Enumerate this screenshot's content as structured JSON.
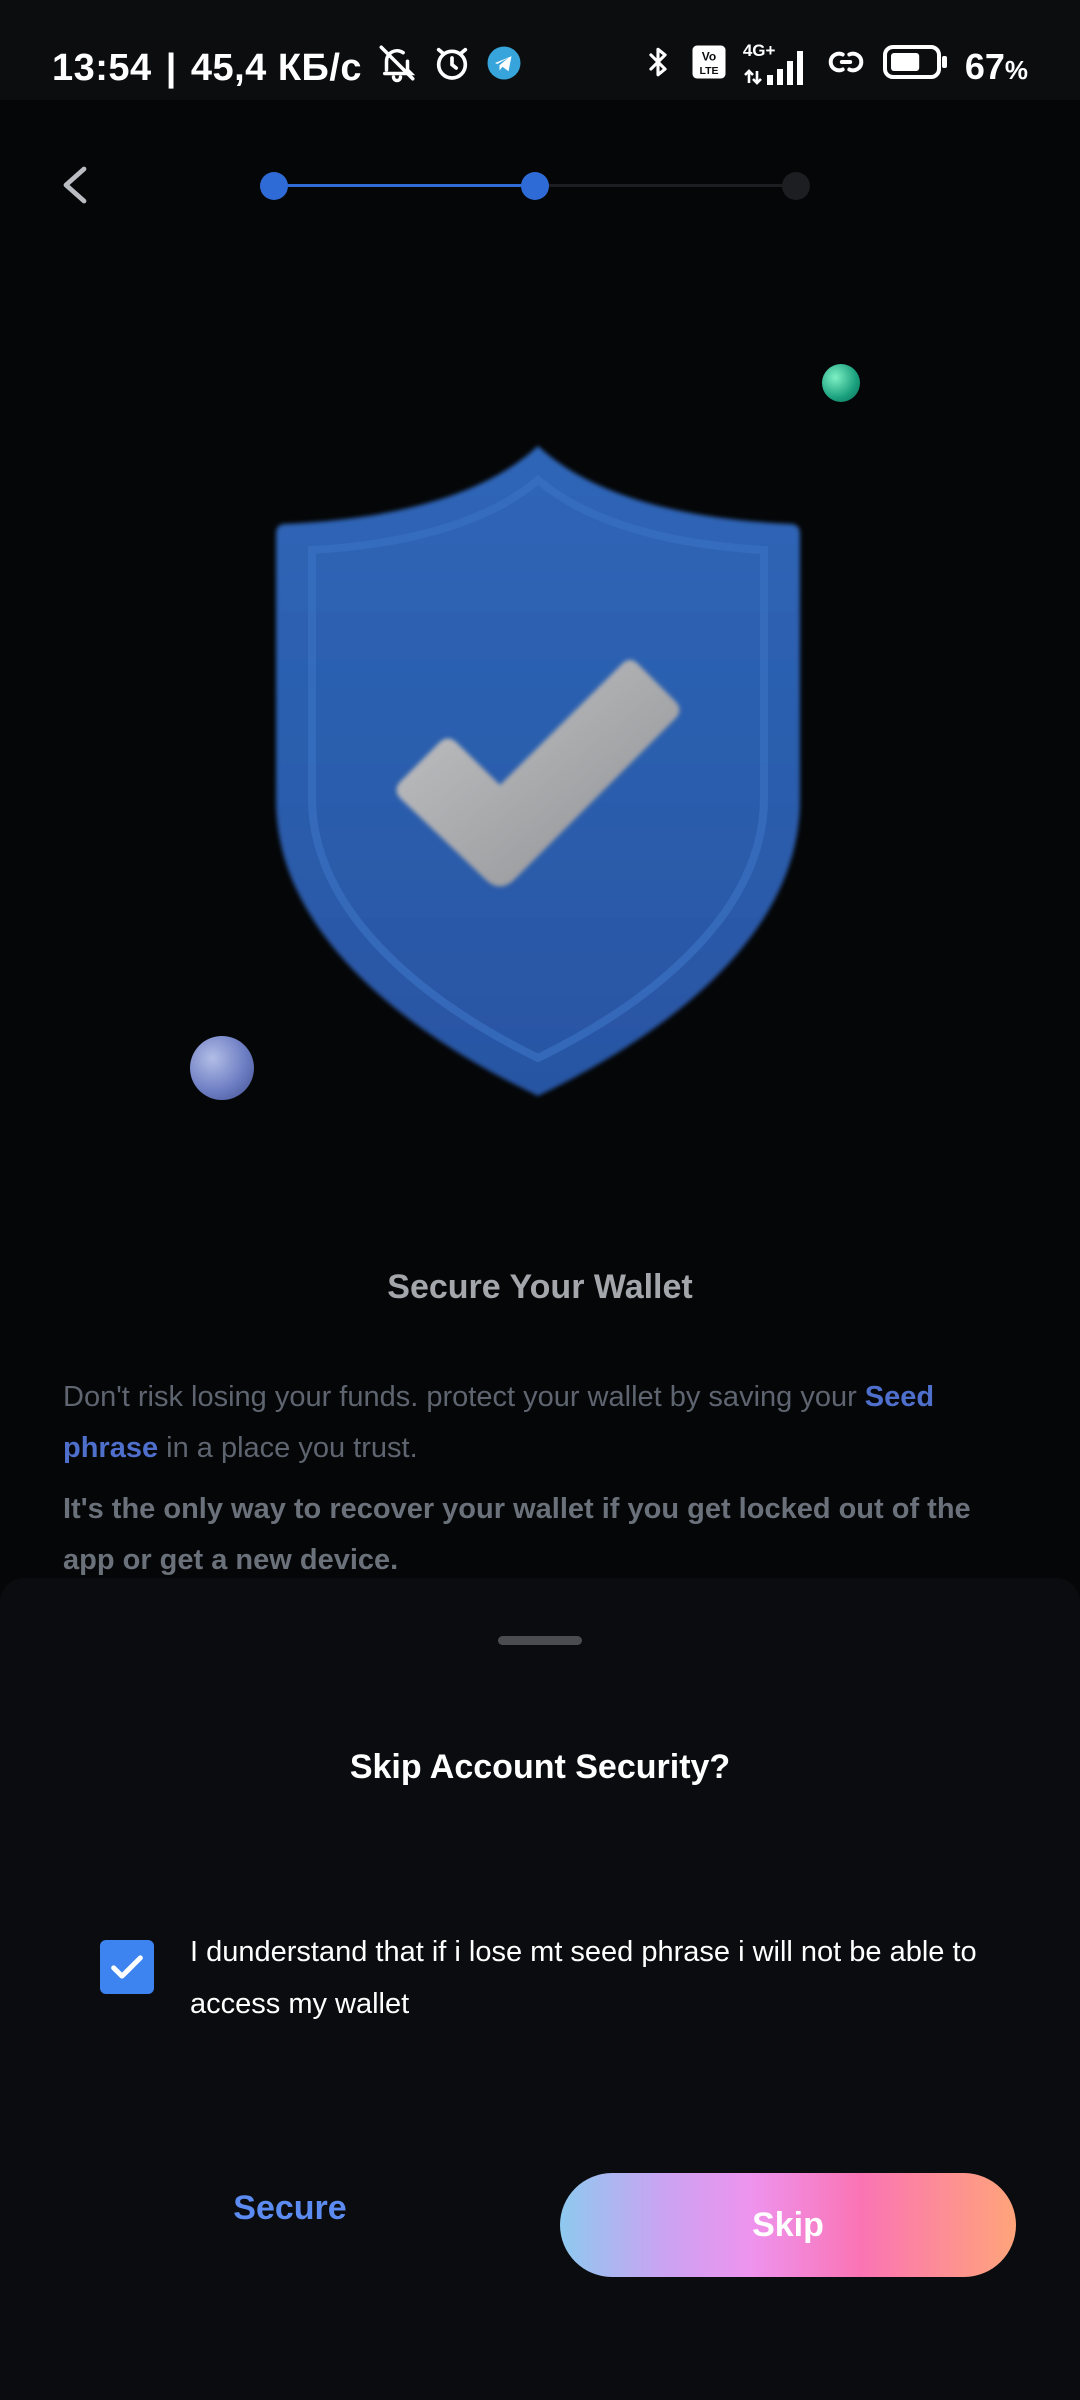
{
  "status_bar": {
    "time": "13:54",
    "separator": "|",
    "network_speed": "45,4 КБ/с",
    "battery_percent": "67",
    "battery_unit": "%",
    "volte_label": "Vo LTE",
    "network_type": "4G+",
    "icons": [
      "mute-bell-icon",
      "alarm-icon",
      "telegram-icon",
      "bluetooth-icon",
      "volte-icon",
      "signal-icon",
      "link-icon",
      "battery-icon"
    ],
    "battery_level": 0.67
  },
  "stepper": {
    "total_steps": 3,
    "active_step": 2,
    "active_color": "#2f6bd6",
    "inactive_color": "#1c1e22"
  },
  "illustration": {
    "name": "shield-check-illustration",
    "shield_color": "#2b5eae",
    "check_color": "#a7a8aa"
  },
  "info": {
    "title": "Secure Your Wallet",
    "p1_before": "Don't risk losing your funds. protect your wallet by saving your ",
    "p1_highlight": "Seed phrase",
    "p1_after": " in a place you trust.",
    "p2": "It's the only way to recover your wallet if you get locked out of the app or get a new device."
  },
  "sheet": {
    "title": "Skip Account Security?",
    "consent_text": "I dunderstand that if i lose mt seed phrase i will not be able to access my wallet",
    "consent_checked": true,
    "secure_label": "Secure",
    "skip_label": "Skip"
  },
  "colors": {
    "background": "#050607",
    "accent_blue": "#3d84f0",
    "link_blue": "#5c8cf2"
  }
}
